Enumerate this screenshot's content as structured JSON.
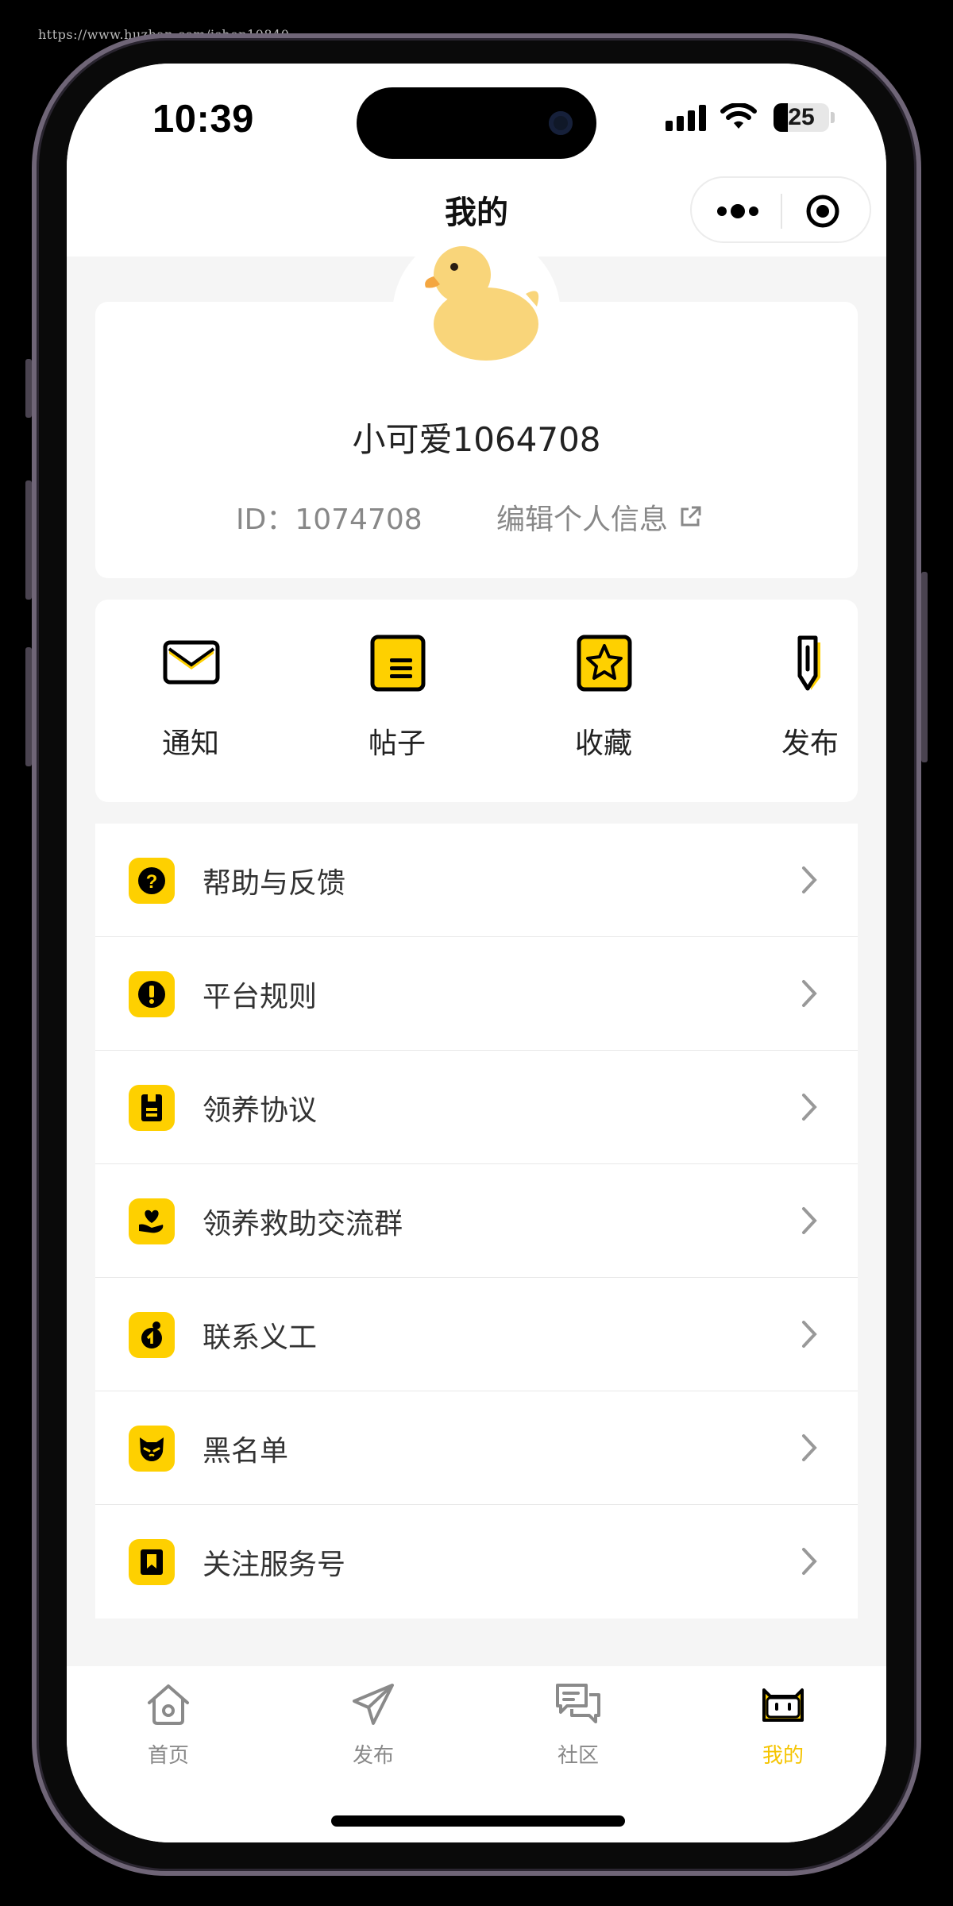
{
  "watermark": "https://www.huzhan.com/ishop10840",
  "status_bar": {
    "time": "10:39",
    "battery": "25",
    "battery_level": 0.25
  },
  "nav": {
    "title": "我的",
    "more_icon": "more-dots-icon",
    "close_icon": "target-icon"
  },
  "profile": {
    "avatar_icon": "duck-avatar-icon",
    "username": "小可爱1064708",
    "id_text": "ID：1074708",
    "edit_label": "编辑个人信息"
  },
  "actions": [
    {
      "label": "通知",
      "icon": "envelope-icon"
    },
    {
      "label": "帖子",
      "icon": "post-list-icon"
    },
    {
      "label": "收藏",
      "icon": "star-icon"
    },
    {
      "label": "发布",
      "icon": "pen-icon"
    }
  ],
  "menu": [
    {
      "label": "帮助与反馈",
      "icon": "help-icon"
    },
    {
      "label": "平台规则",
      "icon": "warning-icon"
    },
    {
      "label": "领养协议",
      "icon": "document-icon"
    },
    {
      "label": "领养救助交流群",
      "icon": "heart-hand-icon"
    },
    {
      "label": "联系义工",
      "icon": "volunteer-icon"
    },
    {
      "label": "黑名单",
      "icon": "cat-face-icon"
    },
    {
      "label": "关注服务号",
      "icon": "bookmark-icon"
    }
  ],
  "tabs": [
    {
      "label": "首页",
      "icon": "home-icon",
      "active": false
    },
    {
      "label": "发布",
      "icon": "send-icon",
      "active": false
    },
    {
      "label": "社区",
      "icon": "chat-icon",
      "active": false
    },
    {
      "label": "我的",
      "icon": "cat-tv-icon",
      "active": true
    }
  ],
  "colors": {
    "accent": "#fed000",
    "active_tab": "#f5c400",
    "text_secondary": "#888888"
  }
}
